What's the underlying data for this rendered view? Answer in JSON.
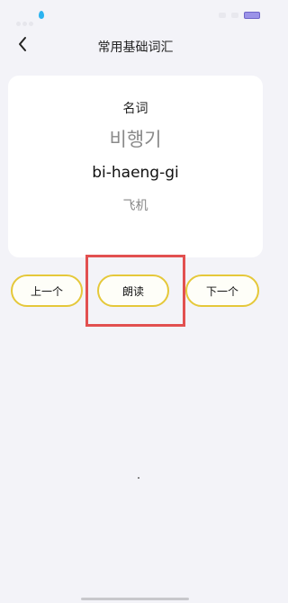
{
  "header": {
    "title": "常用基础词汇"
  },
  "card": {
    "part_of_speech": "名词",
    "korean": "비행기",
    "romanization": "bi-haeng-gi",
    "meaning": "飞机"
  },
  "buttons": {
    "prev_label": "上一个",
    "read_label": "朗读",
    "next_label": "下一个"
  },
  "colors": {
    "background": "#f3f3f8",
    "card": "#ffffff",
    "button_border": "#e5c83a",
    "highlight": "#e25050",
    "battery": "#9b93e8",
    "status_drop": "#2bb3f0"
  }
}
